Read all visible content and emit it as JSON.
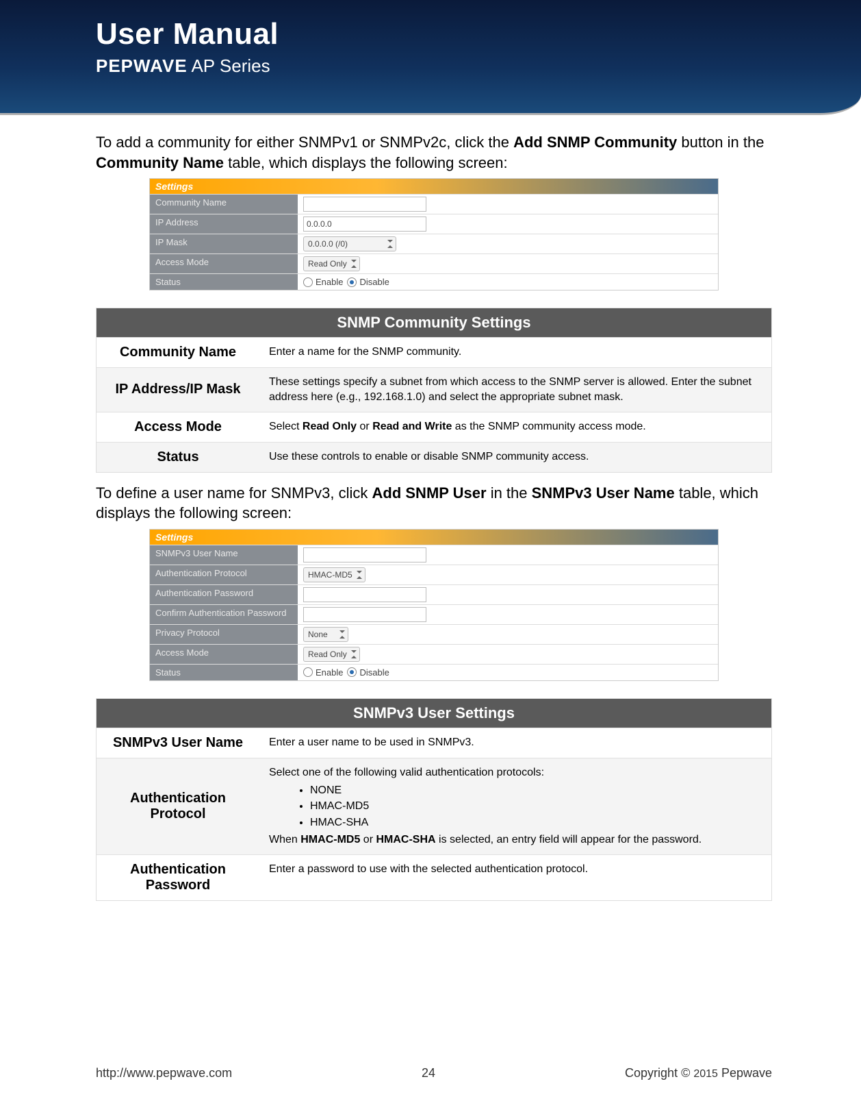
{
  "header": {
    "title": "User Manual",
    "brand": "PEPWAVE",
    "series": " AP Series"
  },
  "intro1_pre": "To add a community for either SNMPv1 or SNMPv2c, click the ",
  "intro1_b1": "Add SNMP Community",
  "intro1_mid": " button in the ",
  "intro1_b2": "Community Name",
  "intro1_post": " table, which displays the following screen:",
  "panel1": {
    "title": "Settings",
    "rows": {
      "community_name": {
        "label": "Community Name",
        "value": ""
      },
      "ip_address": {
        "label": "IP Address",
        "value": "0.0.0.0"
      },
      "ip_mask": {
        "label": "IP Mask",
        "value": "0.0.0.0 (/0)"
      },
      "access_mode": {
        "label": "Access Mode",
        "value": "Read Only"
      },
      "status": {
        "label": "Status",
        "enable": "Enable",
        "disable": "Disable"
      }
    }
  },
  "table1": {
    "title": "SNMP Community Settings",
    "rows": [
      {
        "key": "Community Name",
        "val": "Enter a name for the SNMP community."
      },
      {
        "key": "IP Address/IP Mask",
        "val": "These settings specify a subnet from which access to the SNMP server is allowed. Enter the subnet address here (e.g., 192.168.1.0) and select the appropriate subnet mask."
      },
      {
        "key": "Access Mode",
        "val_pre": "Select ",
        "b1": "Read Only",
        "mid": " or ",
        "b2": "Read and Write",
        "val_post": " as the SNMP community access mode."
      },
      {
        "key": "Status",
        "val": "Use these controls to enable or disable SNMP community access."
      }
    ]
  },
  "intro2_pre": "To define a user name for SNMPv3, click ",
  "intro2_b1": "Add SNMP User",
  "intro2_mid": " in the ",
  "intro2_b2": "SNMPv3 User Name",
  "intro2_post": " table, which displays the following screen:",
  "panel2": {
    "title": "Settings",
    "rows": {
      "user_name": {
        "label": "SNMPv3 User Name",
        "value": ""
      },
      "auth_proto": {
        "label": "Authentication Protocol",
        "value": "HMAC-MD5"
      },
      "auth_pw": {
        "label": "Authentication Password",
        "value": ""
      },
      "auth_pw2": {
        "label": "Confirm Authentication Password",
        "value": ""
      },
      "priv_proto": {
        "label": "Privacy Protocol",
        "value": "None"
      },
      "access_mode": {
        "label": "Access Mode",
        "value": "Read Only"
      },
      "status": {
        "label": "Status",
        "enable": "Enable",
        "disable": "Disable"
      }
    }
  },
  "table2": {
    "title": "SNMPv3 User Settings",
    "rows": {
      "r1": {
        "key": "SNMPv3 User Name",
        "val": "Enter a user name to be used in SNMPv3."
      },
      "r2": {
        "key": "Authentication Protocol",
        "lead": "Select one of the following valid authentication protocols:",
        "opts": [
          "NONE",
          "HMAC-MD5",
          "HMAC-SHA"
        ],
        "tail_pre": "When ",
        "tail_b1": "HMAC-MD5",
        "tail_mid": " or ",
        "tail_b2": "HMAC-SHA",
        "tail_post": " is selected, an entry field will appear for the password."
      },
      "r3": {
        "key": "Authentication Password",
        "val": "Enter a password to use with the selected authentication protocol."
      }
    }
  },
  "footer": {
    "url": "http://www.pepwave.com",
    "page": "24",
    "copyright_pre": "Copyright  ©  ",
    "copyright_year": "2015",
    "copyright_post": "  Pepwave"
  }
}
